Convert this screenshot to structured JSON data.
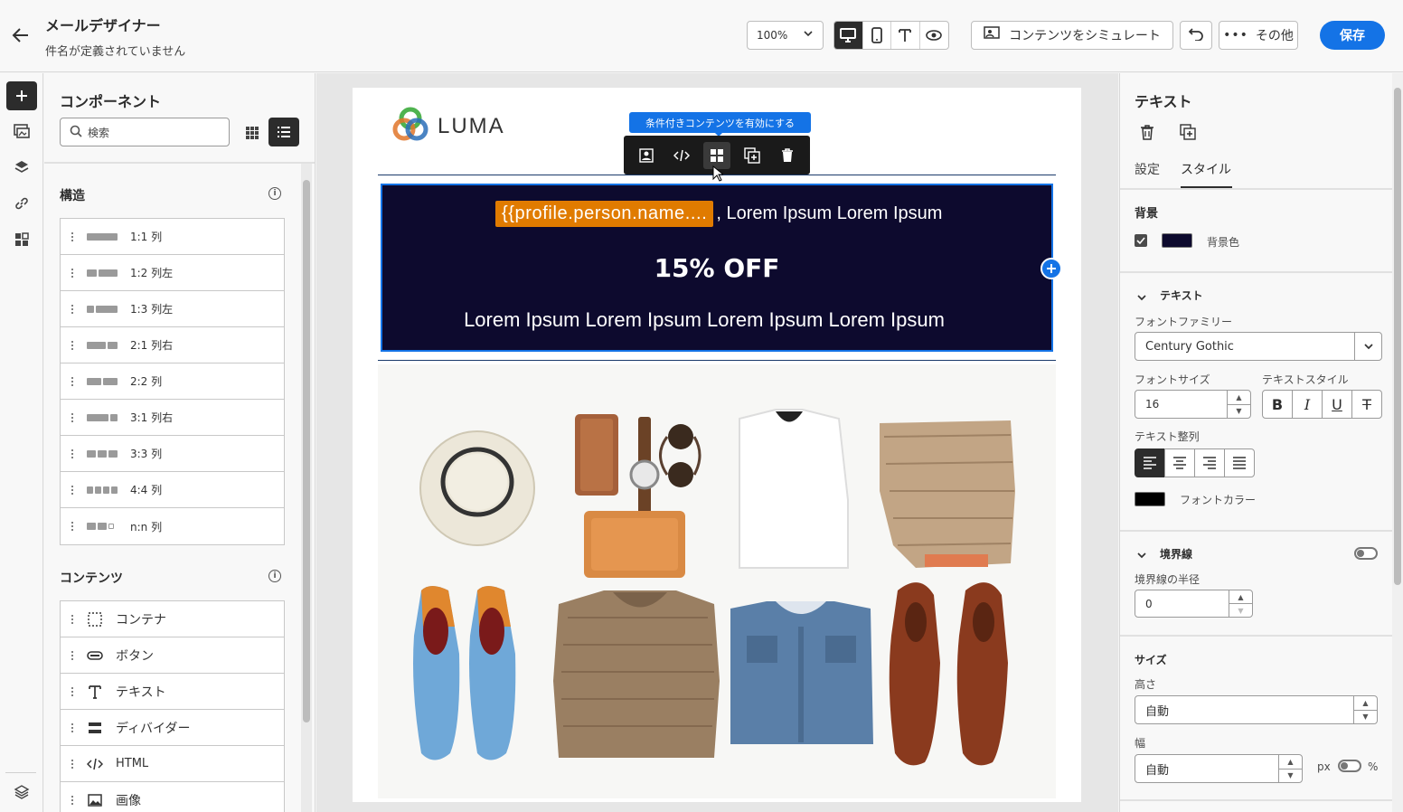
{
  "header": {
    "title": "メールデザイナー",
    "subtitle": "件名が定義されていません",
    "zoom": "100%",
    "simulate_label": "コンテンツをシミュレート",
    "more_label": "その他",
    "save_label": "保存"
  },
  "components": {
    "title": "コンポーネント",
    "search_placeholder": "検索",
    "structure_title": "構造",
    "structures": [
      "1:1 列",
      "1:2 列左",
      "1:3 列左",
      "2:1 列右",
      "2:2 列",
      "3:1 列右",
      "3:3 列",
      "4:4 列",
      "n:n 列"
    ],
    "content_title": "コンテンツ",
    "contents": [
      "コンテナ",
      "ボタン",
      "テキスト",
      "ディバイダー",
      "HTML",
      "画像"
    ]
  },
  "email": {
    "logo_text": "LUMA",
    "tooltip": "条件付きコンテンツを有効にする",
    "personalization_token": "{{profile.person.name....",
    "greeting_suffix": ", Lorem Ipsum Lorem Ipsum",
    "offer": "15% OFF",
    "body_line": "Lorem Ipsum Lorem Ipsum Lorem Ipsum Lorem Ipsum",
    "banner_bg": "#0d0a2e",
    "token_bg": "#e07b00"
  },
  "props": {
    "title": "テキスト",
    "tab_settings": "設定",
    "tab_style": "スタイル",
    "background_title": "背景",
    "background_color_label": "背景色",
    "background_color": "#0d0a2e",
    "text_title": "テキスト",
    "font_family_label": "フォントファミリー",
    "font_family": "Century Gothic",
    "font_size_label": "フォントサイズ",
    "font_size": "16",
    "text_style_label": "テキストスタイル",
    "text_align_label": "テキスト整列",
    "font_color_label": "フォントカラー",
    "font_color": "#000000",
    "border_title": "境界線",
    "border_radius_label": "境界線の半径",
    "border_radius": "0",
    "size_title": "サイズ",
    "height_label": "高さ",
    "height_value": "自動",
    "width_label": "幅",
    "width_value": "自動",
    "unit_px": "px",
    "unit_pct": "%"
  },
  "accent": "#1473e6"
}
